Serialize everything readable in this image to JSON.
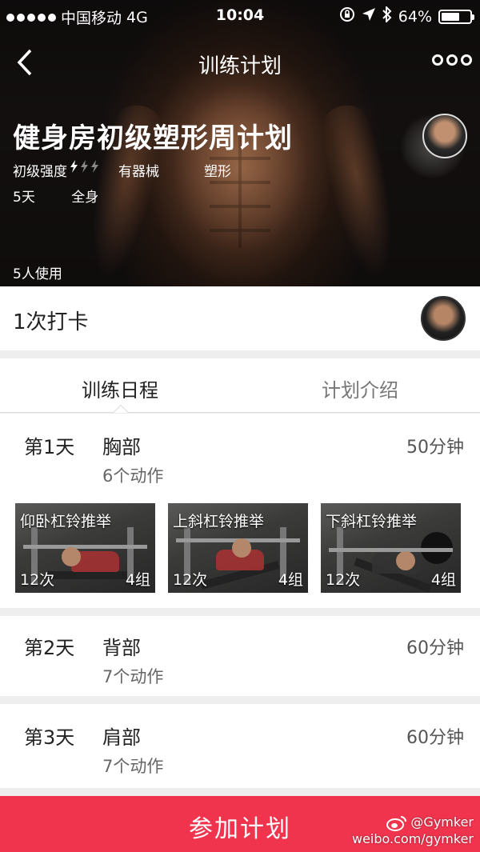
{
  "status_bar": {
    "carrier": "中国移动",
    "network": "4G",
    "time": "10:04",
    "battery": "64%",
    "battery_level": 0.64
  },
  "nav": {
    "title": "训练计划"
  },
  "plan": {
    "title": "健身房初级塑形周计划",
    "intensity": "初级强度",
    "equipment": "有器械",
    "goal": "塑形",
    "days": "5天",
    "body_area": "全身",
    "users": "5人使用"
  },
  "checkin": {
    "label": "1次打卡"
  },
  "tabs": [
    {
      "label": "训练日程"
    },
    {
      "label": "计划介绍"
    }
  ],
  "days": [
    {
      "day": "第1天",
      "part": "胸部",
      "count": "6个动作",
      "duration": "50分钟",
      "exercises": [
        {
          "name": "仰卧杠铃推举",
          "reps": "12次",
          "sets": "4组"
        },
        {
          "name": "上斜杠铃推举",
          "reps": "12次",
          "sets": "4组"
        },
        {
          "name": "下斜杠铃推举",
          "reps": "12次",
          "sets": "4组"
        }
      ]
    },
    {
      "day": "第2天",
      "part": "背部",
      "count": "7个动作",
      "duration": "60分钟"
    },
    {
      "day": "第3天",
      "part": "肩部",
      "count": "7个动作",
      "duration": "60分钟"
    }
  ],
  "join_button": "参加计划",
  "watermark": {
    "handle": "@Gymker",
    "url": "weibo.com/gymker"
  },
  "colors": {
    "accent": "#f0344e"
  }
}
